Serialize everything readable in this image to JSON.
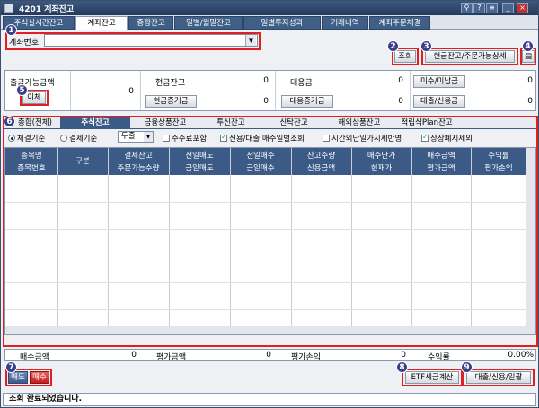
{
  "window": {
    "title": "4201 계좌잔고",
    "controls": [
      "pin-icon",
      "link-icon",
      "menu-icon",
      "minimize-icon",
      "close-icon"
    ]
  },
  "tabs": [
    "주식실시간잔고",
    "계좌잔고",
    "종합잔고",
    "일별/월말잔고",
    "일별투자성과",
    "거래내역",
    "계좌주문체결"
  ],
  "account": {
    "label": "계좌번호",
    "value": ""
  },
  "buttons": {
    "query": "조회",
    "cash_order": "현금잔고/주문가능상세",
    "print_icon": "printer-icon"
  },
  "balances": {
    "withdrawable_label": "출금가능금액",
    "withdrawable_value": "0",
    "transfer_btn": "이체",
    "cash_label": "현금잔고",
    "cash_value": "0",
    "cash_margin_btn": "현금증거금",
    "cash_margin_value": "0",
    "substitute_label": "대용금",
    "substitute_value": "0",
    "substitute_margin_btn": "대용증거금",
    "substitute_margin_value": "0",
    "unpaid_btn": "미수/미납금",
    "unpaid_value": "0",
    "loan_btn": "대출/신용금",
    "loan_value": "0"
  },
  "subtabs": [
    "종합(전체)",
    "주식잔고",
    "금융상품잔고",
    "투신잔고",
    "신탁잔고",
    "해외상품잔고",
    "적립식Plan잔고"
  ],
  "options": {
    "radio1": "체결기준",
    "radio2": "결제기준",
    "select": "두줄",
    "check1": "수수료포함",
    "check2": "신용/대출 매수일별조회",
    "check3": "시간외단일가시세반영",
    "check4": "상장폐지제외"
  },
  "grid": {
    "headers_top": [
      "종목명",
      "구분",
      "결제잔고",
      "전일매도",
      "전일매수",
      "잔고수량",
      "매수단가",
      "매수금액",
      "수익률"
    ],
    "headers_bottom": [
      "종목번호",
      "",
      "주문가능수량",
      "금일매도",
      "금일매수",
      "신용금액",
      "현재가",
      "평가금액",
      "평가손익"
    ]
  },
  "summary": {
    "buy_amount_label": "매수금액",
    "buy_amount_value": "0",
    "eval_amount_label": "평가금액",
    "eval_amount_value": "0",
    "eval_pl_label": "평가손익",
    "eval_pl_value": "0",
    "return_label": "수익률",
    "return_value": "0.00%"
  },
  "bottom": {
    "sell": "매도",
    "buy": "매수",
    "etf_tax": "ETF세금계산",
    "loan_credit": "대출/신용/일괄"
  },
  "status": "조회 완료되었습니다.",
  "badges": [
    "1",
    "2",
    "3",
    "4",
    "5",
    "6",
    "7",
    "8",
    "9"
  ]
}
